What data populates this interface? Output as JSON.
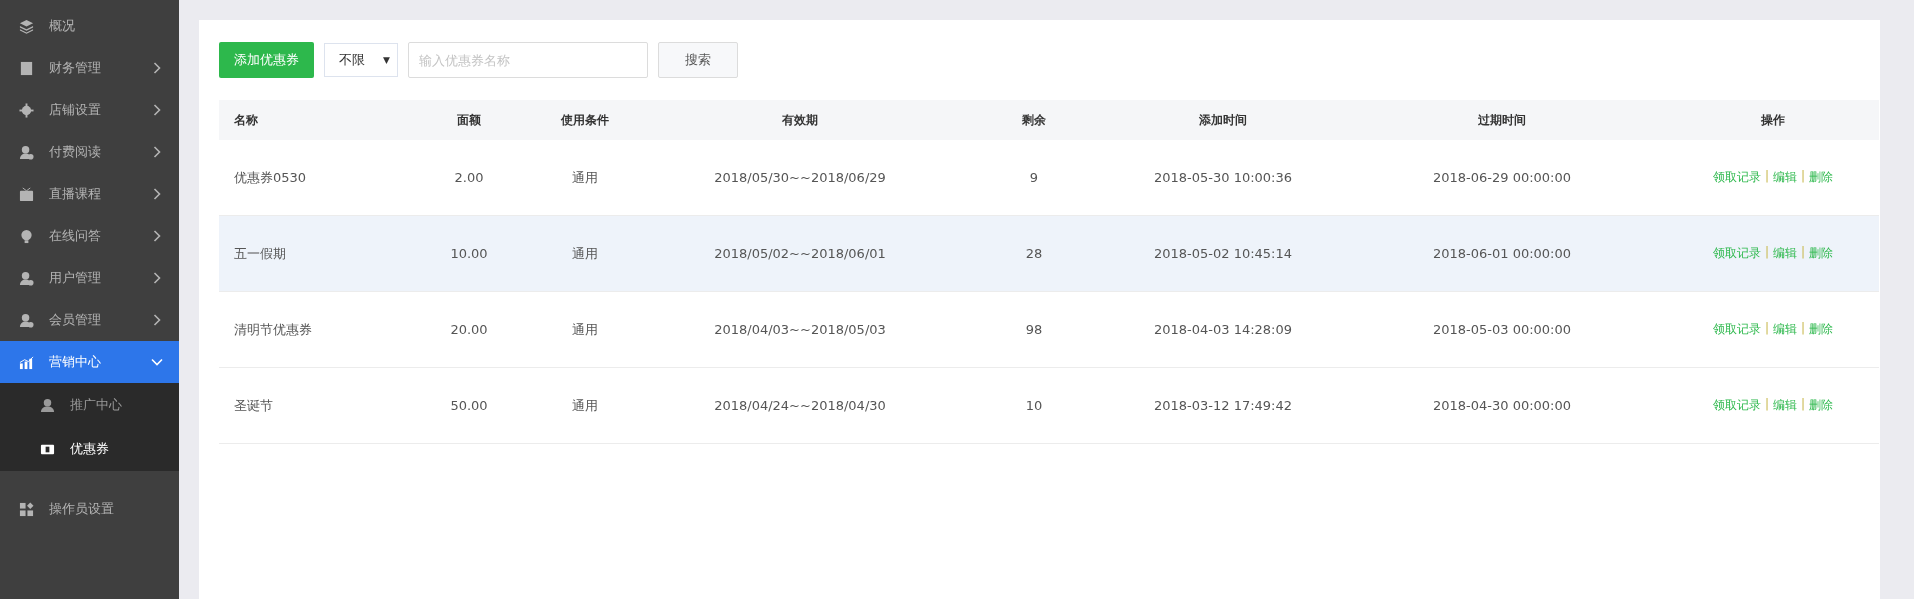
{
  "sidebar": {
    "items": [
      {
        "label": "概况",
        "selected": false
      },
      {
        "label": "财务管理",
        "expanded": false,
        "selected": false
      },
      {
        "label": "店铺设置",
        "expanded": false,
        "selected": false
      },
      {
        "label": "付费阅读",
        "expanded": false,
        "selected": false
      },
      {
        "label": "直播课程",
        "expanded": false,
        "selected": false
      },
      {
        "label": "在线问答",
        "expanded": false,
        "selected": false
      },
      {
        "label": "用户管理",
        "expanded": false,
        "selected": false
      },
      {
        "label": "会员管理",
        "expanded": false,
        "selected": false
      },
      {
        "label": "营销中心",
        "expanded": true,
        "selected": true,
        "children": [
          {
            "label": "推广中心",
            "selected": false
          },
          {
            "label": "优惠券",
            "selected": true
          }
        ]
      },
      {
        "label": "操作员设置",
        "selected": false
      }
    ]
  },
  "toolbar": {
    "add_button": "添加优惠券",
    "filter": {
      "value": "不限",
      "arrow": "▼"
    },
    "search": {
      "placeholder": "输入优惠券名称"
    },
    "search_button": "搜索"
  },
  "table": {
    "columns": [
      "名称",
      "面额",
      "使用条件",
      "有效期",
      "剩余",
      "添加时间",
      "过期时间",
      "操作"
    ],
    "rows": [
      {
        "selected": false,
        "cells": [
          "优惠券0530",
          "2.00",
          "通用",
          "2018/05/30~~2018/06/29",
          "9",
          "2018-05-30 10:00:36",
          "2018-06-29 00:00:00"
        ],
        "actions": [
          {
            "kind": "link",
            "text": "领取记录"
          },
          {
            "kind": "separator",
            "text": "|"
          },
          {
            "kind": "link",
            "text": "编辑"
          },
          {
            "kind": "separator",
            "text": "|"
          },
          {
            "kind": "link",
            "text": "删除"
          }
        ]
      },
      {
        "selected": true,
        "cells": [
          "五一假期",
          "10.00",
          "通用",
          "2018/05/02~~2018/06/01",
          "28",
          "2018-05-02 10:45:14",
          "2018-06-01 00:00:00"
        ],
        "actions": [
          {
            "kind": "link",
            "text": "领取记录"
          },
          {
            "kind": "separator",
            "text": "|"
          },
          {
            "kind": "link",
            "text": "编辑"
          },
          {
            "kind": "separator",
            "text": "|"
          },
          {
            "kind": "link",
            "text": "删除"
          }
        ]
      },
      {
        "selected": false,
        "cells": [
          "清明节优惠券",
          "20.00",
          "通用",
          "2018/04/03~~2018/05/03",
          "98",
          "2018-04-03 14:28:09",
          "2018-05-03 00:00:00"
        ],
        "actions": [
          {
            "kind": "link",
            "text": "领取记录"
          },
          {
            "kind": "separator",
            "text": "|"
          },
          {
            "kind": "link",
            "text": "编辑"
          },
          {
            "kind": "separator",
            "text": "|"
          },
          {
            "kind": "link",
            "text": "删除"
          }
        ]
      },
      {
        "selected": false,
        "cells": [
          "圣诞节",
          "50.00",
          "通用",
          "2018/04/24~~2018/04/30",
          "10",
          "2018-03-12 17:49:42",
          "2018-04-30 00:00:00"
        ],
        "actions": [
          {
            "kind": "link",
            "text": "领取记录"
          },
          {
            "kind": "separator",
            "text": "|"
          },
          {
            "kind": "link",
            "text": "编辑"
          },
          {
            "kind": "separator",
            "text": "|"
          },
          {
            "kind": "link",
            "text": "删除"
          }
        ]
      }
    ]
  }
}
